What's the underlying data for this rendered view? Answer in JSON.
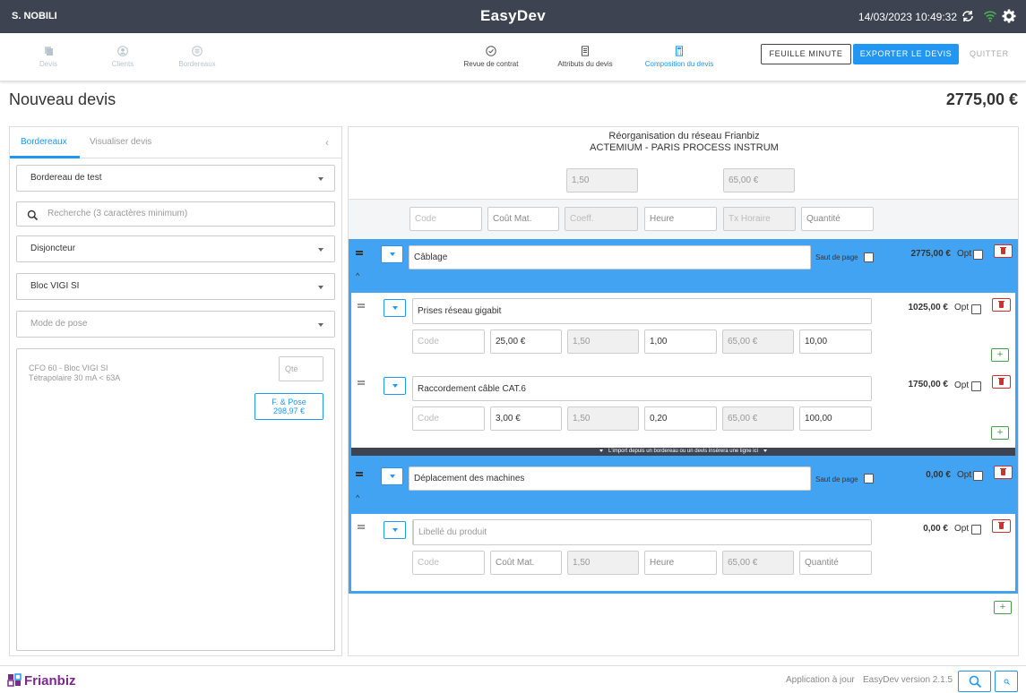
{
  "topbar": {
    "user": "S. NOBILI",
    "app_title": "EasyDev",
    "datetime": "14/03/2023 10:49:32",
    "icons": [
      "sync-icon",
      "wifi-icon",
      "gear-icon"
    ]
  },
  "nav": {
    "left": [
      {
        "label": "Devis",
        "icon": "copy-icon"
      },
      {
        "label": "Clients",
        "icon": "user-icon"
      },
      {
        "label": "Bordereaux",
        "icon": "list-icon"
      }
    ],
    "center": [
      {
        "label": "Revue de contrat",
        "icon": "check-circle-icon"
      },
      {
        "label": "Attributs du devis",
        "icon": "document-icon"
      },
      {
        "label": "Composition du devis",
        "icon": "calculator-icon"
      }
    ],
    "btn_feuille": "FEUILLE MINUTE",
    "btn_exporter": "EXPORTER LE DEVIS",
    "btn_quitter": "QUITTER"
  },
  "page": {
    "title": "Nouveau devis",
    "total": "2775,00 €"
  },
  "left": {
    "tabs": [
      "Bordereaux",
      "Visualiser devis"
    ],
    "select_bordereau": "Bordereau de test",
    "search_placeholder": "Recherche (3 caractères minimum)",
    "select_disjoncteur": "Disjoncteur",
    "select_bloc": "Bloc VIGI SI",
    "select_pose_placeholder": "Mode de pose",
    "product": {
      "line1": "CFO 60 - Bloc VIGI SI",
      "line2": "Tétrapolaire 30 mA < 63A",
      "qte_placeholder": "Qté",
      "fpose_label": "F. & Pose",
      "fpose_price": "298,97 €"
    }
  },
  "right": {
    "project_title": "Réorganisation du réseau Frianbiz",
    "client": "ACTEMIUM - PARIS PROCESS INSTRUM",
    "coeff": "1,50",
    "taux": "65,00 €",
    "header_placeholders": {
      "code": "Code",
      "cout": "Coût Mat.",
      "coeff": "Coeff.",
      "heure": "Heure",
      "taux": "Tx Horaire",
      "quantite": "Quantité"
    },
    "saut_label": "Saut de page",
    "opt_label": "Opt",
    "import_text": "L'import depuis un bordereau ou un devis insèrera une ligne ici",
    "sections": [
      {
        "title": "Câblage",
        "price": "2775,00 €",
        "lines": [
          {
            "label": "Prises réseau gigabit",
            "code_placeholder": "Code",
            "cout": "25,00 €",
            "coeff": "1,50",
            "heure": "1,00",
            "taux": "65,00 €",
            "quantite": "10,00",
            "price": "1025,00 €"
          },
          {
            "label": "Raccordement câble CAT.6",
            "code_placeholder": "Code",
            "cout": "3,00 €",
            "coeff": "1,50",
            "heure": "0,20",
            "taux": "65,00 €",
            "quantite": "100,00",
            "price": "1750,00 €"
          }
        ]
      },
      {
        "title": "Déplacement des machines",
        "price": "0,00 €",
        "lines": [
          {
            "label_placeholder": "Libellé du produit",
            "code_placeholder": "Code",
            "cout_placeholder": "Coût Mat.",
            "coeff": "1,50",
            "heure_placeholder": "Heure",
            "taux": "65,00 €",
            "quantite_placeholder": "Quantité",
            "price": "0,00 €"
          }
        ]
      }
    ]
  },
  "footer": {
    "brand": "Frianbiz",
    "update": "Application à jour",
    "version": "EasyDev version 2.1.5",
    "icons": [
      "search-icon",
      "small-search-icon"
    ]
  }
}
